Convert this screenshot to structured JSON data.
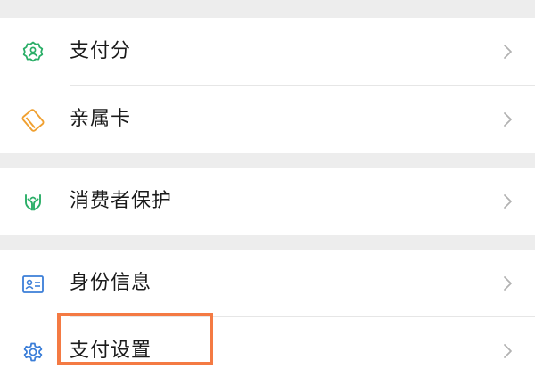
{
  "menu": {
    "group1": [
      {
        "label": "支付分",
        "icon": "pay-score-badge-icon",
        "icon_color": "#2aae67"
      },
      {
        "label": "亲属卡",
        "icon": "family-card-icon",
        "icon_color": "#f0a030"
      }
    ],
    "group2": [
      {
        "label": "消费者保护",
        "icon": "hands-protection-icon",
        "icon_color": "#2aae67"
      }
    ],
    "group3": [
      {
        "label": "身份信息",
        "icon": "id-card-icon",
        "icon_color": "#3b7ed8"
      },
      {
        "label": "支付设置",
        "icon": "gear-icon",
        "icon_color": "#3b7ed8"
      }
    ]
  },
  "highlight": {
    "target": "支付设置",
    "color": "#f47a43"
  }
}
